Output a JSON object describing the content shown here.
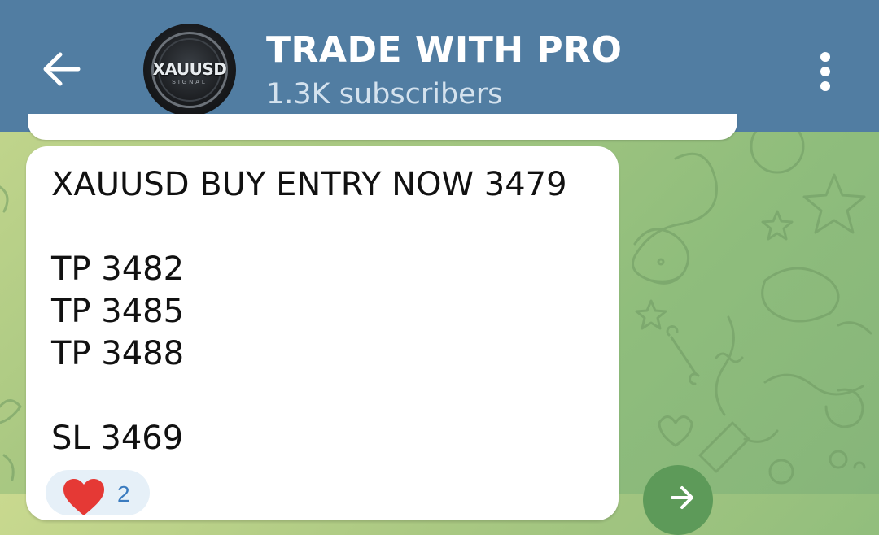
{
  "header": {
    "channel_title": "TRADE WITH PRO",
    "subscribers": "1.3K subscribers",
    "avatar_text": "XAUUSD",
    "avatar_subtext": "SIGNAL"
  },
  "message": {
    "lines": [
      "XAUUSD BUY ENTRY NOW 3479",
      "TP 3482",
      "TP 3485",
      "TP 3488",
      "SL 3469"
    ],
    "reaction": {
      "emoji": "heart-icon",
      "count": "2"
    }
  },
  "colors": {
    "header_bg": "#517da2",
    "reaction_bg": "#e6f0f8",
    "heart": "#e53935",
    "share_button": "#5d9a59"
  }
}
